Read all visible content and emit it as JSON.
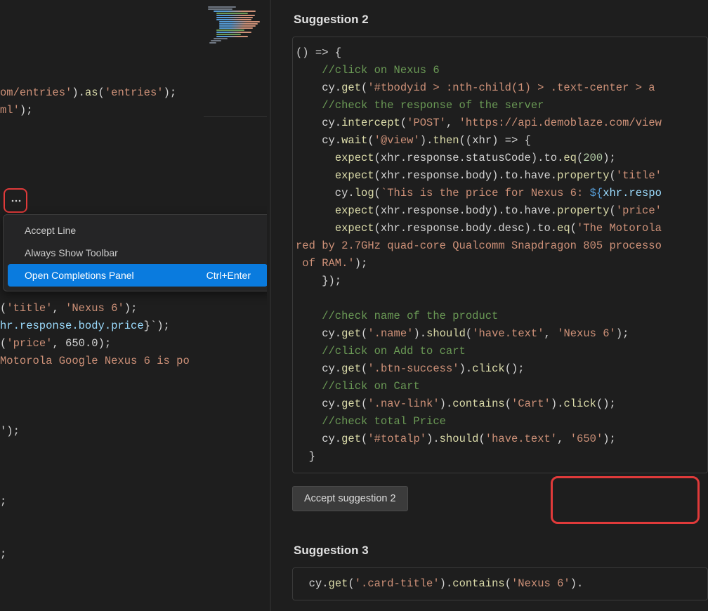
{
  "editor": {
    "snippet_top": {
      "line1_a": "om/entries'",
      "line1_b": ").",
      "line1_c": "as",
      "line1_d": "(",
      "line1_e": "'entries'",
      "line1_f": ");",
      "line2_a": "ml'",
      "line2_b": ");"
    },
    "snippet_bottom": {
      "l1_a": "(",
      "l1_b": "'title'",
      "l1_c": ", ",
      "l1_d": "'Nexus 6'",
      "l1_e": ");",
      "l2_a": "hr.response.body.price",
      "l2_b": "}`);",
      "l3_a": "(",
      "l3_b": "'price'",
      "l3_c": ", ",
      "l3_d": "650.0",
      "l3_e": ");",
      "l4": "Motorola Google Nexus 6 is po",
      "l5": "');",
      "l6": ";",
      "l7": ";"
    }
  },
  "context_menu": {
    "item1": {
      "label": "Accept Line"
    },
    "item2": {
      "label": "Always Show Toolbar"
    },
    "item3": {
      "label": "Open Completions Panel",
      "shortcut": "Ctrl+Enter"
    }
  },
  "suggestions": {
    "s2": {
      "title": "Suggestion 2",
      "accept_label": "Accept suggestion 2",
      "code": {
        "l01": "() => {",
        "l02": "    //click on Nexus 6",
        "l03a": "    cy.",
        "l03b": "get",
        "l03c": "(",
        "l03d": "'#tbodyid > :nth-child(1) > .text-center > a",
        "l04": "    //check the response of the server",
        "l05a": "    cy.",
        "l05b": "intercept",
        "l05c": "(",
        "l05d": "'POST'",
        "l05e": ", ",
        "l05f": "'https://api.demoblaze.com/view",
        "l06a": "    cy.",
        "l06b": "wait",
        "l06c": "(",
        "l06d": "'@view'",
        "l06e": ").",
        "l06f": "then",
        "l06g": "((xhr) => {",
        "l07a": "      ",
        "l07b": "expect",
        "l07c": "(xhr.response.statusCode).to.",
        "l07d": "eq",
        "l07e": "(",
        "l07f": "200",
        "l07g": ");",
        "l08a": "      ",
        "l08b": "expect",
        "l08c": "(xhr.response.body).to.have.",
        "l08d": "property",
        "l08e": "(",
        "l08f": "'title'",
        "l09a": "      cy.",
        "l09b": "log",
        "l09c": "(",
        "l09d": "`This is the price for Nexus 6: ",
        "l09e": "${",
        "l09f": "xhr.respo",
        "l10a": "      ",
        "l10b": "expect",
        "l10c": "(xhr.response.body).to.have.",
        "l10d": "property",
        "l10e": "(",
        "l10f": "'price'",
        "l11a": "      ",
        "l11b": "expect",
        "l11c": "(xhr.response.body.desc).to.",
        "l11d": "eq",
        "l11e": "(",
        "l11f": "'The Motorola",
        "l12": "red by 2.7GHz quad-core Qualcomm Snapdragon 805 processo",
        "l13a": " of RAM.'",
        "l13b": ");",
        "l14": "    });",
        "blank1": "",
        "l15": "    //check name of the product",
        "l16a": "    cy.",
        "l16b": "get",
        "l16c": "(",
        "l16d": "'.name'",
        "l16e": ").",
        "l16f": "should",
        "l16g": "(",
        "l16h": "'have.text'",
        "l16i": ", ",
        "l16j": "'Nexus 6'",
        "l16k": ");",
        "l17": "    //click on Add to cart",
        "l18a": "    cy.",
        "l18b": "get",
        "l18c": "(",
        "l18d": "'.btn-success'",
        "l18e": ").",
        "l18f": "click",
        "l18g": "();",
        "l19": "    //click on Cart",
        "l20a": "    cy.",
        "l20b": "get",
        "l20c": "(",
        "l20d": "'.nav-link'",
        "l20e": ").",
        "l20f": "contains",
        "l20g": "(",
        "l20h": "'Cart'",
        "l20i": ").",
        "l20j": "click",
        "l20k": "();",
        "l21": "    //check total Price",
        "l22a": "    cy.",
        "l22b": "get",
        "l22c": "(",
        "l22d": "'#totalp'",
        "l22e": ").",
        "l22f": "should",
        "l22g": "(",
        "l22h": "'have.text'",
        "l22i": ", ",
        "l22j": "'650'",
        "l22k": ");",
        "l23": "  }"
      }
    },
    "s3": {
      "title": "Suggestion 3",
      "code": {
        "l1a": "  cy.",
        "l1b": "get",
        "l1c": "(",
        "l1d": "'.card-title'",
        "l1e": ").",
        "l1f": "contains",
        "l1g": "(",
        "l1h": "'Nexus 6'",
        "l1i": ")."
      }
    }
  }
}
